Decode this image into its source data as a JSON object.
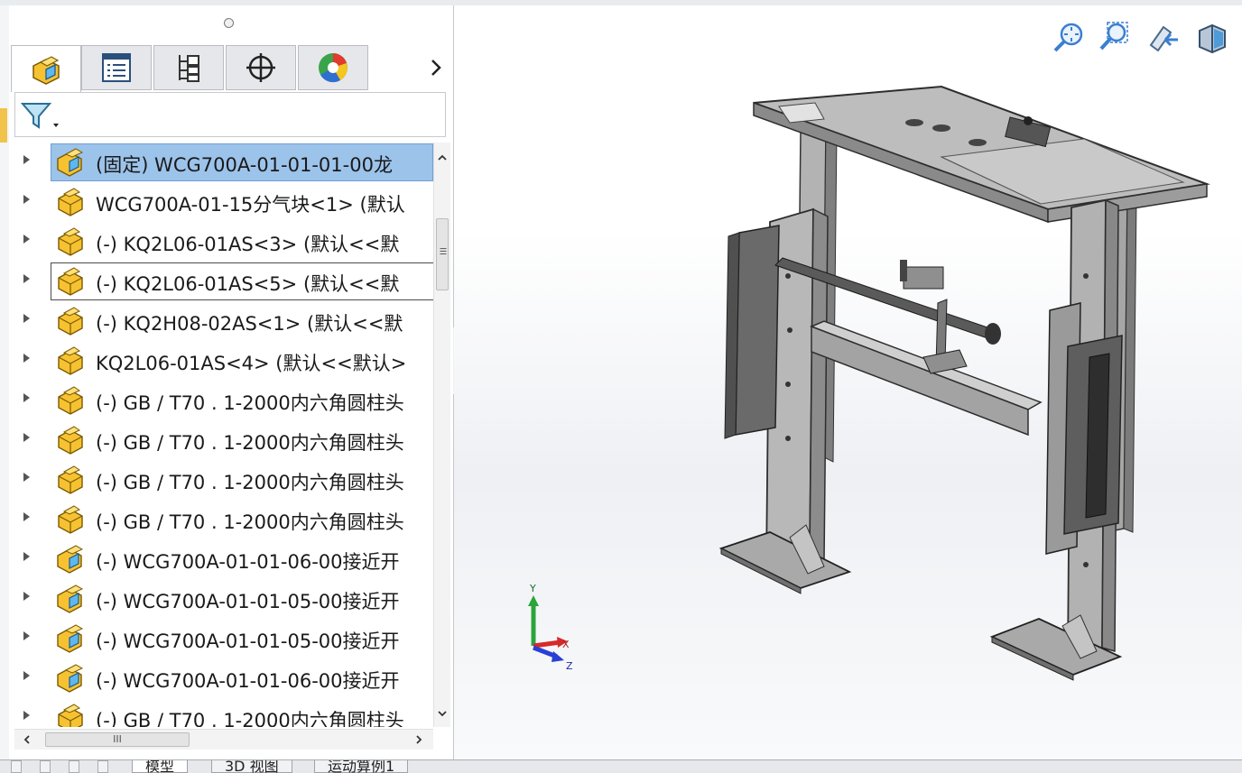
{
  "panel": {
    "tabs": [
      {
        "icon": "assembly-icon"
      },
      {
        "icon": "property-manager-icon"
      },
      {
        "icon": "configuration-manager-icon"
      },
      {
        "icon": "dimxpert-icon"
      },
      {
        "icon": "display-manager-icon"
      }
    ],
    "tree": [
      {
        "label": "(固定) WCG700A-01-01-01-00龙",
        "icon": "subassembly-icon",
        "selected": true
      },
      {
        "label": "WCG700A-01-15分气块<1> (默认",
        "icon": "part-icon"
      },
      {
        "label": "(-) KQ2L06-01AS<3> (默认<<默",
        "icon": "part-icon"
      },
      {
        "label": "(-) KQ2L06-01AS<5> (默认<<默",
        "icon": "part-icon",
        "focused": true
      },
      {
        "label": "(-) KQ2H08-02AS<1> (默认<<默",
        "icon": "part-icon"
      },
      {
        "label": "KQ2L06-01AS<4> (默认<<默认>",
        "icon": "part-icon"
      },
      {
        "label": "(-) GB / T70 . 1-2000内六角圆柱头",
        "icon": "part-icon"
      },
      {
        "label": "(-) GB / T70 . 1-2000内六角圆柱头",
        "icon": "part-icon"
      },
      {
        "label": "(-) GB / T70 . 1-2000内六角圆柱头",
        "icon": "part-icon"
      },
      {
        "label": "(-) GB / T70 . 1-2000内六角圆柱头",
        "icon": "part-icon"
      },
      {
        "label": "(-) WCG700A-01-01-06-00接近开",
        "icon": "subassembly-icon"
      },
      {
        "label": "(-) WCG700A-01-01-05-00接近开",
        "icon": "subassembly-icon"
      },
      {
        "label": "(-) WCG700A-01-01-05-00接近开",
        "icon": "subassembly-icon"
      },
      {
        "label": "(-) WCG700A-01-01-06-00接近开",
        "icon": "subassembly-icon"
      },
      {
        "label": "(-) GB / T70 . 1-2000内六角圆柱头",
        "icon": "part-icon"
      }
    ],
    "hscroll_grip": "III",
    "vscroll_grip": "III"
  },
  "triad": {
    "y": "Y",
    "x": "X",
    "z": "Z"
  },
  "bottom_tabs": [
    "模型",
    "3D 视图",
    "运动算例1"
  ],
  "colors": {
    "selection": "#9cc3ea",
    "part_yellow": "#f6c232",
    "accent_blue": "#3a7fd0"
  }
}
